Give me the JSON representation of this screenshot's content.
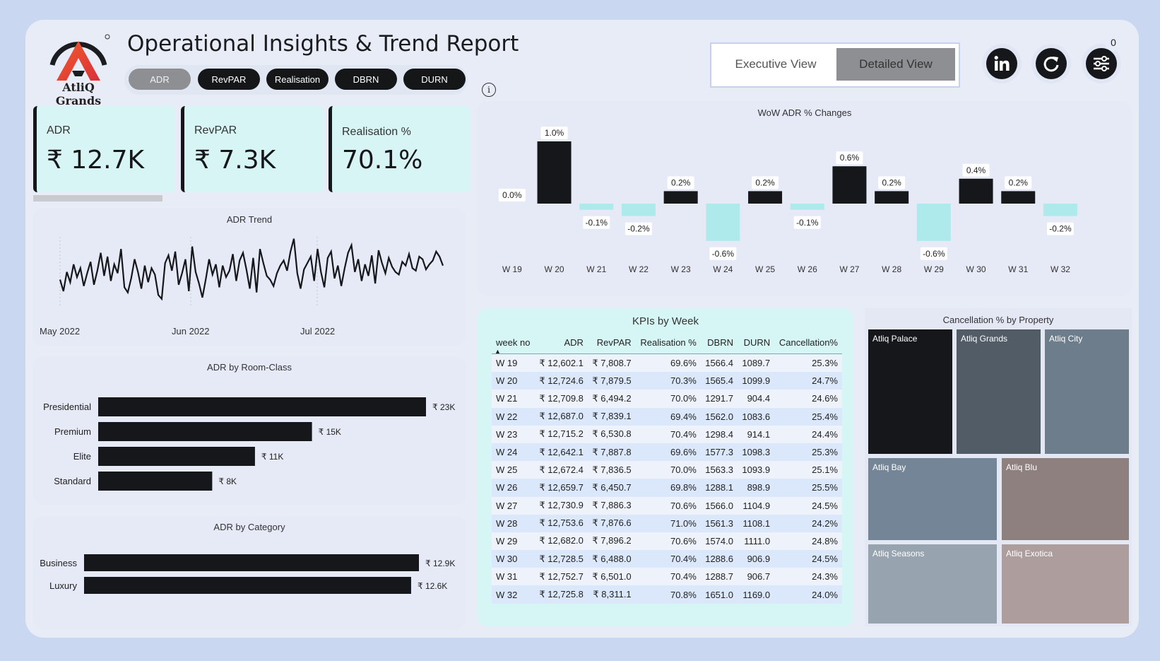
{
  "header": {
    "brand": "AtliQ Grands",
    "title": "Operational Insights & Trend Report",
    "metric_tabs": [
      {
        "label": "ADR",
        "active": true
      },
      {
        "label": "RevPAR",
        "active": false
      },
      {
        "label": "Realisation",
        "active": false
      },
      {
        "label": "DBRN",
        "active": false
      },
      {
        "label": "DURN",
        "active": false
      }
    ],
    "views": [
      {
        "label": "Executive View",
        "selected": false
      },
      {
        "label": "Detailed View",
        "selected": true
      }
    ],
    "icons": [
      "linkedin-icon",
      "refresh-icon",
      "filter-settings-icon"
    ],
    "filter_badge": "0",
    "info_glyph": "i"
  },
  "kpi_cards": [
    {
      "label": "ADR",
      "value": "₹ 12.7K"
    },
    {
      "label": "RevPAR",
      "value": "₹ 7.3K"
    },
    {
      "label": "Realisation %",
      "value": "70.1%"
    }
  ],
  "adr_trend": {
    "title": "ADR Trend",
    "x_labels": [
      "May 2022",
      "Jun 2022",
      "Jul 2022"
    ],
    "series_shape": [
      48,
      30,
      60,
      44,
      72,
      52,
      66,
      38,
      58,
      76,
      40,
      62,
      90,
      54,
      84,
      46,
      72,
      58,
      96,
      36,
      28,
      50,
      80,
      60,
      34,
      70,
      44,
      66,
      56,
      24,
      18,
      74,
      86,
      62,
      92,
      40,
      58,
      80,
      30,
      100,
      60,
      42,
      20,
      48,
      80,
      56,
      72,
      36,
      70,
      52,
      62,
      88,
      46,
      78,
      90,
      64,
      34,
      82,
      28,
      96,
      74,
      54,
      48,
      38,
      58,
      70,
      78,
      62,
      92,
      112,
      58,
      34,
      64,
      74,
      84,
      46,
      96,
      60,
      36,
      82,
      92,
      50,
      70,
      38,
      66,
      90,
      102,
      60,
      80,
      46,
      72,
      54,
      86,
      42,
      94,
      74,
      58,
      82,
      68,
      60,
      56,
      76,
      70,
      88,
      66,
      62,
      84,
      80,
      64,
      72,
      78,
      92,
      84,
      70
    ]
  },
  "room_class": {
    "title": "ADR by Room-Class",
    "rows": [
      {
        "label": "Presidential",
        "value": 23,
        "display": "₹ 23K"
      },
      {
        "label": "Premium",
        "value": 15,
        "display": "₹ 15K"
      },
      {
        "label": "Elite",
        "value": 11,
        "display": "₹ 11K"
      },
      {
        "label": "Standard",
        "value": 8,
        "display": "₹ 8K"
      }
    ]
  },
  "category": {
    "title": "ADR by Category",
    "rows": [
      {
        "label": "Business",
        "value": 12.9,
        "display": "₹ 12.9K"
      },
      {
        "label": "Luxury",
        "value": 12.6,
        "display": "₹ 12.6K"
      }
    ]
  },
  "chart_data": {
    "type": "bar",
    "title": "WoW ADR % Changes",
    "categories": [
      "W 19",
      "W 20",
      "W 21",
      "W 22",
      "W 23",
      "W 24",
      "W 25",
      "W 26",
      "W 27",
      "W 28",
      "W 29",
      "W 30",
      "W 31",
      "W 32"
    ],
    "values": [
      0.0,
      1.0,
      -0.1,
      -0.2,
      0.2,
      -0.6,
      0.2,
      -0.1,
      0.6,
      0.2,
      -0.6,
      0.4,
      0.2,
      -0.2
    ],
    "labels": [
      "0.0%",
      "1.0%",
      "-0.1%",
      "-0.2%",
      "0.2%",
      "-0.6%",
      "0.2%",
      "-0.1%",
      "0.6%",
      "0.2%",
      "-0.6%",
      "0.4%",
      "0.2%",
      "-0.2%"
    ],
    "colors": {
      "positive": "#15171a",
      "negative": "#aeeaec"
    }
  },
  "kpi_table": {
    "title": "KPIs by Week",
    "columns": [
      "week no",
      "ADR",
      "RevPAR",
      "Realisation %",
      "DBRN",
      "DURN",
      "Cancellation%"
    ],
    "rows": [
      [
        "W 19",
        "₹ 12,602.1",
        "₹ 7,808.7",
        "69.6%",
        "1566.4",
        "1089.7",
        "25.3%"
      ],
      [
        "W 20",
        "₹ 12,724.6",
        "₹ 7,879.5",
        "70.3%",
        "1565.4",
        "1099.9",
        "24.7%"
      ],
      [
        "W 21",
        "₹ 12,709.8",
        "₹ 6,494.2",
        "70.0%",
        "1291.7",
        "904.4",
        "24.6%"
      ],
      [
        "W 22",
        "₹ 12,687.0",
        "₹ 7,839.1",
        "69.4%",
        "1562.0",
        "1083.6",
        "25.4%"
      ],
      [
        "W 23",
        "₹ 12,715.2",
        "₹ 6,530.8",
        "70.4%",
        "1298.4",
        "914.1",
        "24.4%"
      ],
      [
        "W 24",
        "₹ 12,642.1",
        "₹ 7,887.8",
        "69.6%",
        "1577.3",
        "1098.3",
        "25.3%"
      ],
      [
        "W 25",
        "₹ 12,672.4",
        "₹ 7,836.5",
        "70.0%",
        "1563.3",
        "1093.9",
        "25.1%"
      ],
      [
        "W 26",
        "₹ 12,659.7",
        "₹ 6,450.7",
        "69.8%",
        "1288.1",
        "898.9",
        "25.5%"
      ],
      [
        "W 27",
        "₹ 12,730.9",
        "₹ 7,886.3",
        "70.6%",
        "1566.0",
        "1104.9",
        "24.5%"
      ],
      [
        "W 28",
        "₹ 12,753.6",
        "₹ 7,876.6",
        "71.0%",
        "1561.3",
        "1108.1",
        "24.2%"
      ],
      [
        "W 29",
        "₹ 12,682.0",
        "₹ 7,896.2",
        "70.6%",
        "1574.0",
        "1111.0",
        "24.8%"
      ],
      [
        "W 30",
        "₹ 12,728.5",
        "₹ 6,488.0",
        "70.4%",
        "1288.6",
        "906.9",
        "24.5%"
      ],
      [
        "W 31",
        "₹ 12,752.7",
        "₹ 6,501.0",
        "70.4%",
        "1288.7",
        "906.7",
        "24.3%"
      ],
      [
        "W 32",
        "₹ 12,725.8",
        "₹ 8,311.1",
        "70.8%",
        "1651.0",
        "1169.0",
        "24.0%"
      ]
    ]
  },
  "cancellation": {
    "title": "Cancellation % by Property",
    "properties": [
      {
        "name": "Atliq Palace",
        "color": "#15171a"
      },
      {
        "name": "Atliq Grands",
        "color": "#525c66"
      },
      {
        "name": "Atliq City",
        "color": "#6e7d8c"
      },
      {
        "name": "Atliq Bay",
        "color": "#738596"
      },
      {
        "name": "Atliq Blu",
        "color": "#8f8080"
      },
      {
        "name": "Atliq Seasons",
        "color": "#97a4b0"
      },
      {
        "name": "Atliq Exotica",
        "color": "#ad9e9d"
      }
    ]
  }
}
